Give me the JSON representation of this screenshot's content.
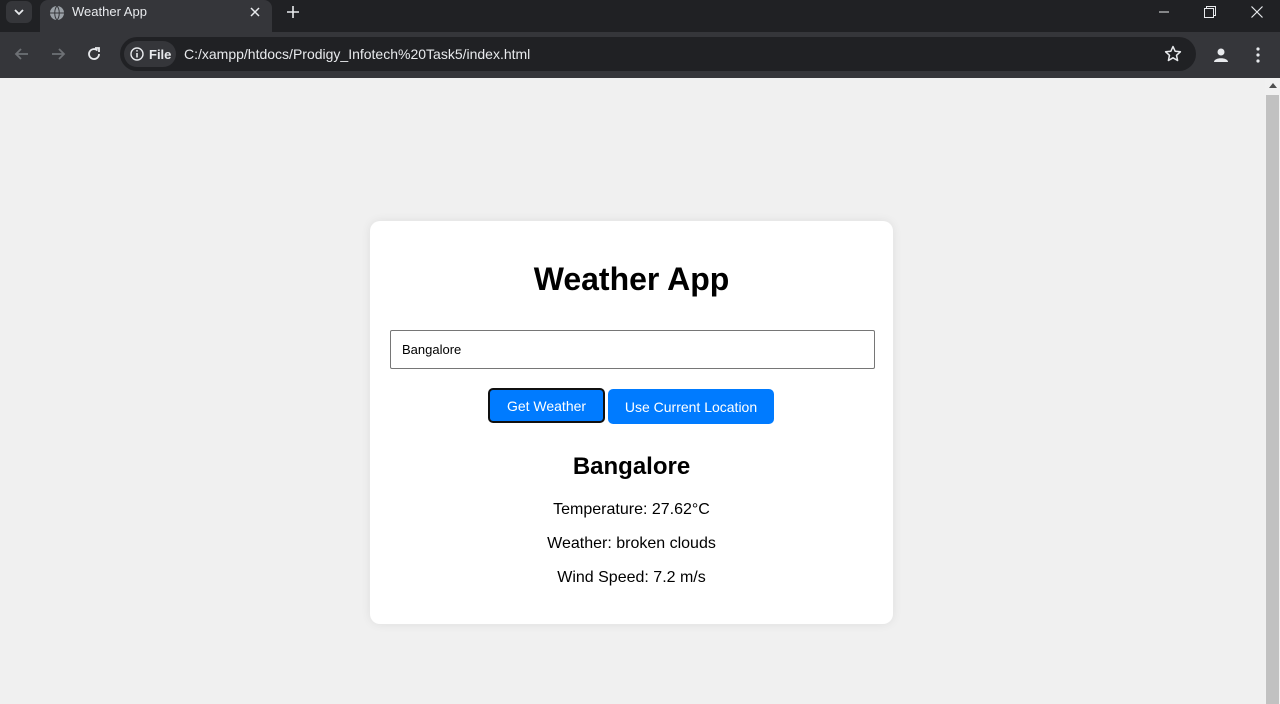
{
  "browser": {
    "tab_title": "Weather App",
    "site_chip_label": "File",
    "url": "C:/xampp/htdocs/Prodigy_Infotech%20Task5/index.html",
    "icons": {
      "tab_search": "chevron-down-icon",
      "favicon": "globe-icon",
      "tab_close": "close-icon",
      "new_tab": "plus-icon",
      "back": "back-arrow-icon",
      "forward": "forward-arrow-icon",
      "reload": "reload-icon",
      "info": "info-icon",
      "bookmark": "star-icon",
      "profile": "profile-icon",
      "menu": "kebab-menu-icon",
      "minimize": "minimize-icon",
      "restore": "restore-icon",
      "close": "close-window-icon"
    }
  },
  "app": {
    "title": "Weather App",
    "city_input_value": "Bangalore",
    "get_weather_label": "Get Weather",
    "use_location_label": "Use Current Location",
    "result": {
      "city": "Bangalore",
      "temperature": "Temperature: 27.62°C",
      "weather": "Weather: broken clouds",
      "wind_speed": "Wind Speed: 7.2 m/s"
    }
  },
  "colors": {
    "button": "#007bff",
    "page_background": "#f0f0f0",
    "card_background": "#ffffff",
    "chrome_dark": "#202124",
    "chrome_toolbar": "#35363a"
  }
}
